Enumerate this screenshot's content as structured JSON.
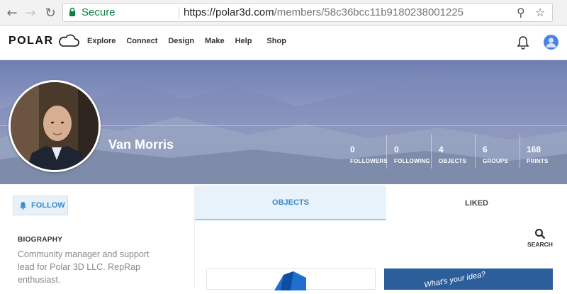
{
  "browser": {
    "back_icon": "back-arrow-icon",
    "forward_icon": "forward-arrow-icon",
    "reload_icon": "reload-icon",
    "secure_label": "Secure",
    "url_base": "https://polar3d.com",
    "url_path": "/members/58c36bcc11b9180238001225",
    "zoom_icon": "zoom-icon",
    "star_icon": "star-icon"
  },
  "header": {
    "logo_text": "POLAR",
    "nav": [
      "Explore",
      "Connect",
      "Design",
      "Make",
      "Help",
      "Shop"
    ],
    "bell_icon": "bell-icon",
    "avatar_icon": "user-avatar"
  },
  "profile": {
    "name": "Van Morris",
    "stats": [
      {
        "value": "0",
        "label": "FOLLOWERS"
      },
      {
        "value": "0",
        "label": "FOLLOWING"
      },
      {
        "value": "4",
        "label": "OBJECTS"
      },
      {
        "value": "6",
        "label": "GROUPS"
      },
      {
        "value": "168",
        "label": "PRINTS"
      }
    ]
  },
  "sidebar": {
    "follow_label": "FOLLOW",
    "bio_title": "BIOGRAPHY",
    "bio_text": "Community manager and support lead for Polar 3D LLC. RepRap enthusiast."
  },
  "tabs": {
    "objects": "OBJECTS",
    "liked": "LIKED"
  },
  "search": {
    "label": "SEARCH"
  },
  "cards": {
    "card2_text": "What's your idea?"
  },
  "colors": {
    "accent": "#3a8bd1",
    "secure_green": "#0b8043"
  }
}
